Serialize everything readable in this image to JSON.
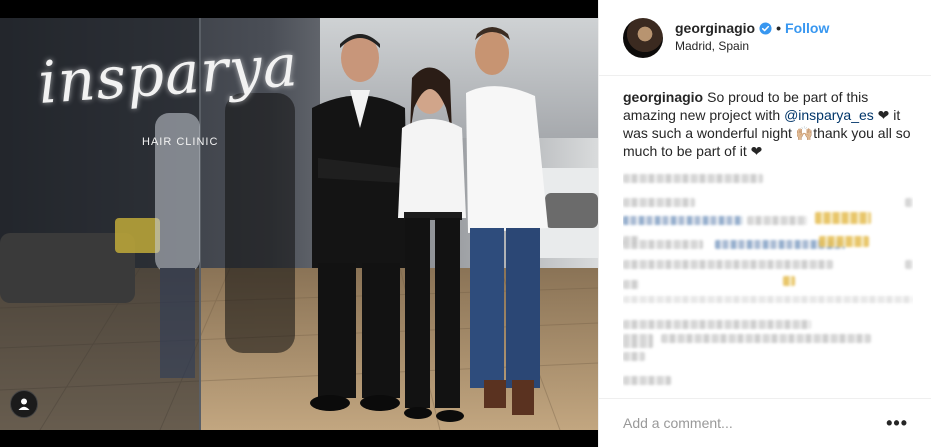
{
  "photo": {
    "sign_text": "insparya",
    "sign_subtext": "HAIR CLINIC",
    "user_tag_icon": "user-icon"
  },
  "header": {
    "username": "georginagio",
    "verified_icon": "verified-badge-icon",
    "separator": "•",
    "follow_label": "Follow",
    "location": "Madrid, Spain"
  },
  "caption": {
    "username": "georginagio",
    "text_before_mention": "So proud to be part of this amazing new project with ",
    "mention": "@insparya_es",
    "text_after_mention": " ❤ it was such a wonderful night 🙌🏼thank you all so much to be part of it ❤"
  },
  "footer": {
    "comment_placeholder": "Add a comment...",
    "more_label": "•••"
  },
  "colors": {
    "link_blue": "#3897f0",
    "mention_blue": "#003569",
    "border": "#efefef",
    "text": "#262626"
  }
}
